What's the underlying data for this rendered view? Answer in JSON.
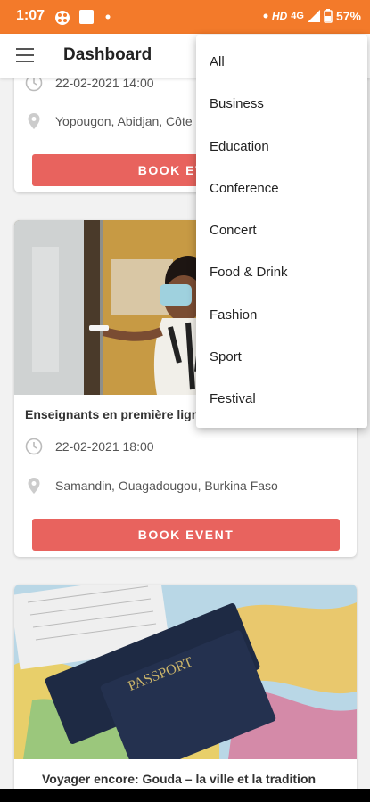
{
  "status_bar": {
    "time": "1:07",
    "hd": "HD",
    "network": "4G",
    "battery": "57%"
  },
  "app_bar": {
    "title": "Dashboard"
  },
  "events": [
    {
      "title": "",
      "date": "22-02-2021 14:00",
      "location": "Yopougon, Abidjan, Côte",
      "button": "BOOK EVENT"
    },
    {
      "title": "Enseignants en première ligne",
      "date": "22-02-2021 18:00",
      "location": "Samandin, Ouagadougou, Burkina Faso",
      "button": "BOOK EVENT"
    },
    {
      "title": "Voyager encore: Gouda – la ville et la tradition"
    }
  ],
  "dropdown": {
    "items": [
      "All",
      "Business",
      "Education",
      "Conference",
      "Concert",
      "Food & Drink",
      "Fashion",
      "Sport",
      "Festival"
    ]
  },
  "photo_text": {
    "passport": "PASSPORT"
  },
  "colors": {
    "accent": "#f37a2a",
    "button": "#e8635e"
  }
}
